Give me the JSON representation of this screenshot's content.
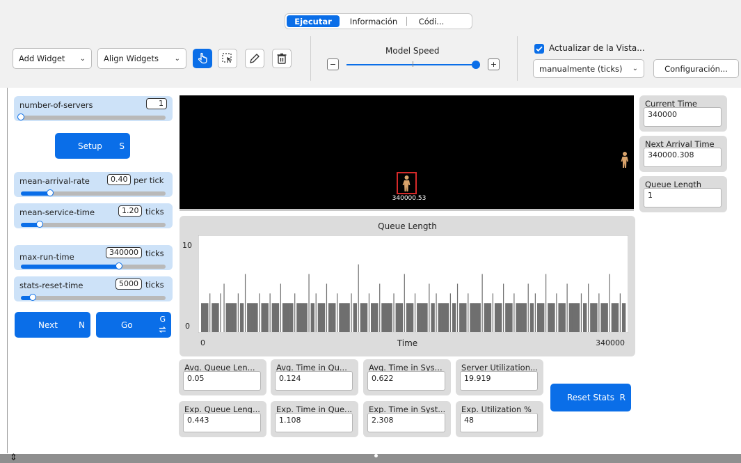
{
  "tabs": [
    {
      "label": "Ejecutar",
      "active": true
    },
    {
      "label": "Información",
      "active": false
    },
    {
      "label": "Códi...",
      "active": false
    }
  ],
  "toolbar": {
    "add_widget": "Add Widget",
    "align_widgets": "Align Widgets",
    "model_speed_label": "Model Speed",
    "speed_level": 0.97,
    "speed_minus": "−",
    "speed_plus": "+",
    "update_view_label": "Actualizar de la Vista...",
    "update_view_checked": true,
    "update_mode": "manualmente (ticks)",
    "settings_button": "Configuración..."
  },
  "sliders": [
    {
      "label": "number-of-servers",
      "value": "1",
      "unit": "",
      "fraction": 0.0
    },
    {
      "label": "mean-arrival-rate",
      "value": "0.40",
      "unit": "per tick",
      "fraction": 0.2
    },
    {
      "label": "mean-service-time",
      "value": "1.20",
      "unit": "ticks",
      "fraction": 0.13
    },
    {
      "label": "max-run-time",
      "value": "340000",
      "unit": "ticks",
      "fraction": 0.68
    },
    {
      "label": "stats-reset-time",
      "value": "5000",
      "unit": "ticks",
      "fraction": 0.08
    }
  ],
  "buttons": {
    "setup": {
      "label": "Setup",
      "key": "S"
    },
    "next": {
      "label": "Next",
      "key": "N"
    },
    "go": {
      "label": "Go",
      "key": "G"
    },
    "reset_stats": {
      "label": "Reset Stats",
      "key": "R"
    }
  },
  "view": {
    "patch_label": "340000.53"
  },
  "monitors_right": [
    {
      "label": "Current Time",
      "value": "340000"
    },
    {
      "label": "Next Arrival Time",
      "value": "340000.308"
    },
    {
      "label": "Queue Length",
      "value": "1"
    }
  ],
  "monitors_bottom": [
    {
      "label": "Avg. Queue Len...",
      "value": "0.05"
    },
    {
      "label": "Avg. Time in Qu...",
      "value": "0.124"
    },
    {
      "label": "Avg. Time in Sys...",
      "value": "0.622"
    },
    {
      "label": "Server Utilization...",
      "value": "19.919"
    },
    {
      "label": "Exp. Queue Leng...",
      "value": "0.443"
    },
    {
      "label": "Exp. Time in Que...",
      "value": "1.108"
    },
    {
      "label": "Exp. Time in Syst...",
      "value": "2.308"
    },
    {
      "label": "Exp. Utilization %",
      "value": "48"
    }
  ],
  "colors": {
    "accent": "#0a6ee8",
    "slider_bg": "#cde2f8",
    "view_bg": "#000000",
    "agent": "#d9a36b",
    "server_box": "#d62a2a"
  },
  "chart_data": {
    "type": "bar",
    "title": "Queue Length",
    "xlabel": "Time",
    "ylabel": "",
    "xlim": [
      0,
      340000
    ],
    "ylim": [
      0,
      10
    ],
    "x_ticks": [
      "0",
      "340000"
    ],
    "y_ticks": [
      "0",
      "10"
    ],
    "baseline_value": 3,
    "values_estimated": [
      3,
      3,
      4,
      3,
      3,
      4,
      5,
      3,
      3,
      3,
      4,
      3,
      6,
      3,
      3,
      3,
      4,
      3,
      3,
      4,
      3,
      3,
      5,
      3,
      3,
      3,
      4,
      3,
      3,
      3,
      6,
      3,
      4,
      3,
      3,
      5,
      3,
      3,
      4,
      3,
      3,
      3,
      4,
      3,
      7,
      3,
      3,
      4,
      3,
      3,
      5,
      3,
      3,
      3,
      4,
      3,
      3,
      6,
      3,
      3,
      4,
      3,
      3,
      3,
      5,
      3,
      4,
      3,
      3,
      3,
      4,
      3,
      5,
      3,
      3,
      4,
      3,
      3,
      3,
      6,
      3,
      3,
      4,
      3,
      3,
      5,
      3,
      3,
      4,
      3,
      3,
      3,
      5,
      3,
      4,
      3,
      3,
      6,
      3,
      3,
      4,
      3,
      3,
      5,
      3,
      3,
      3,
      4,
      3,
      5,
      3,
      3,
      4,
      3,
      3,
      6,
      3,
      3,
      4,
      3
    ]
  }
}
